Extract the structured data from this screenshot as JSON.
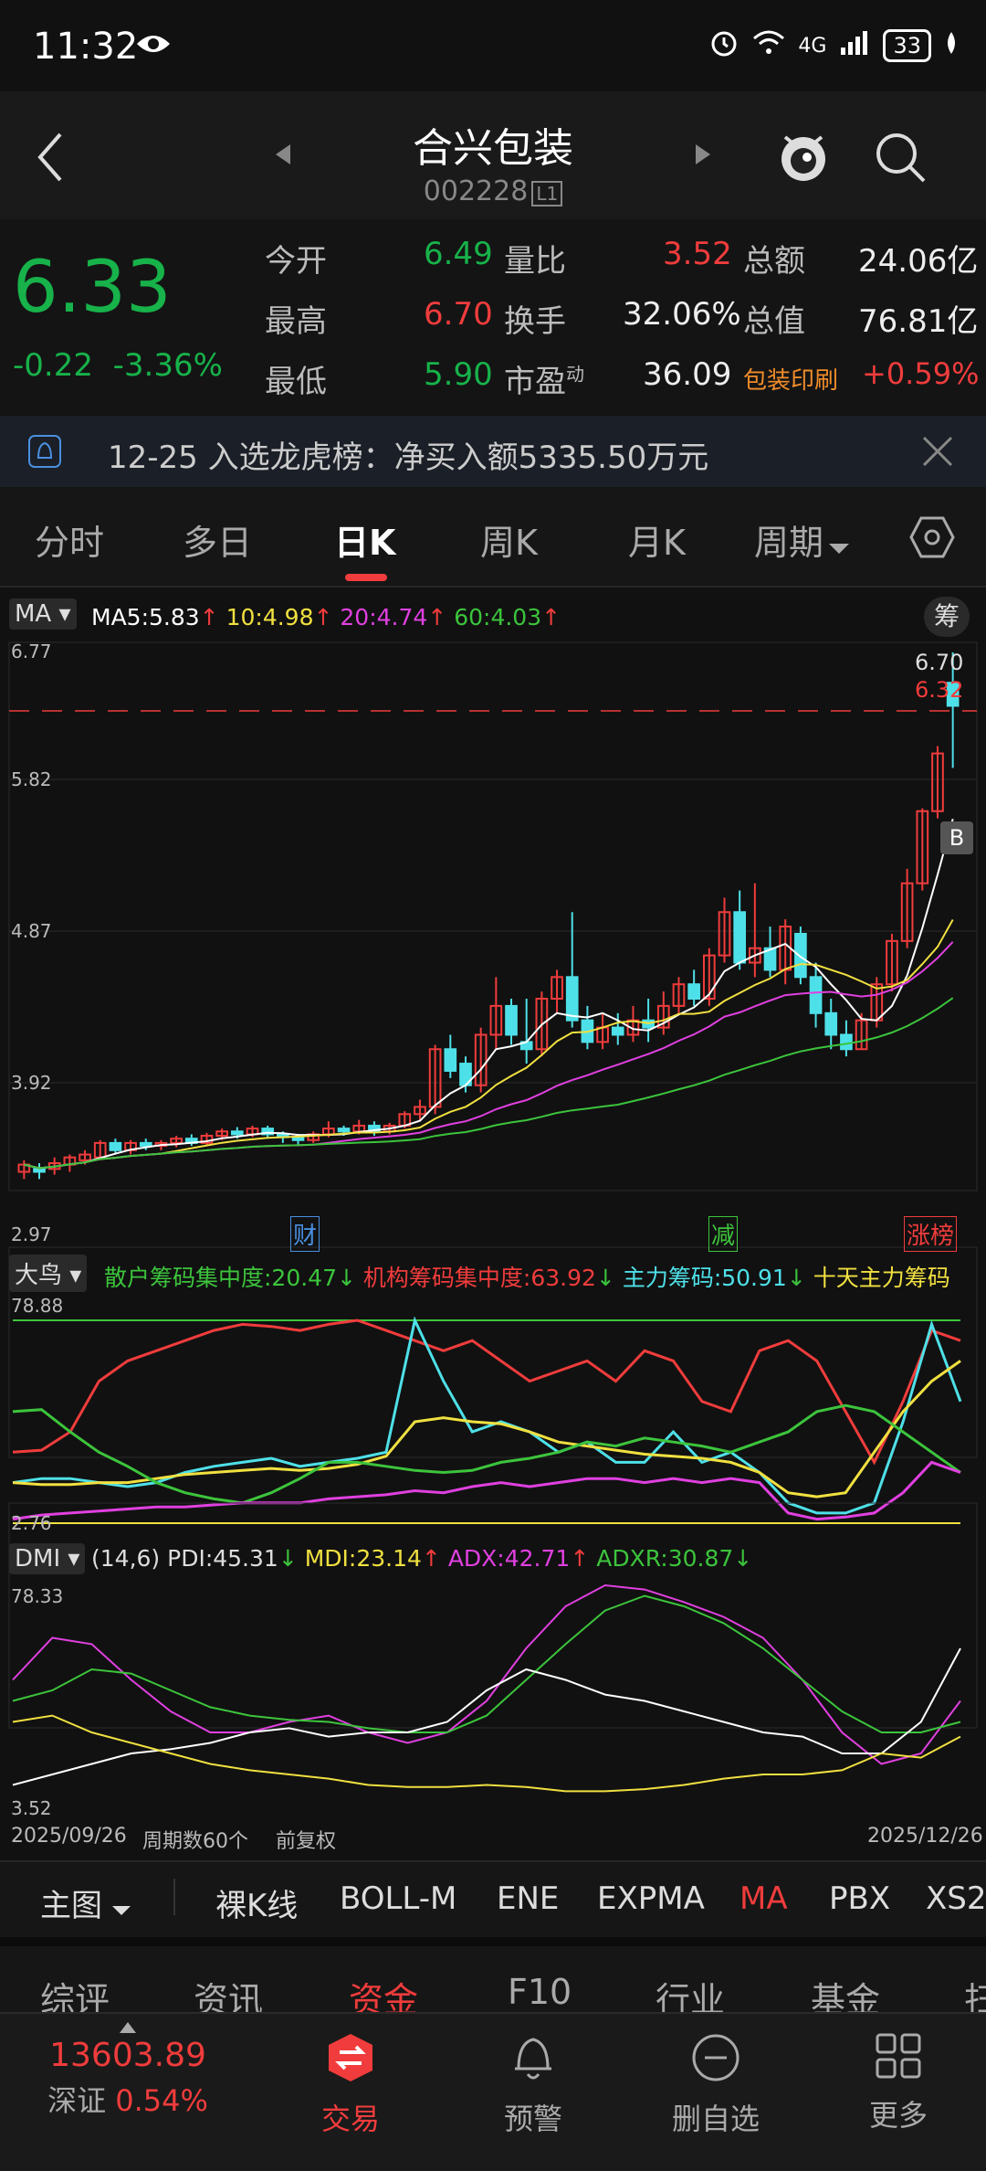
{
  "status": {
    "time": "11:32",
    "network": "4G",
    "battery": "33"
  },
  "header": {
    "title": "合兴包装",
    "code": "002228",
    "code_tag": "L1"
  },
  "quote": {
    "price": "6.33",
    "change": "-0.22",
    "change_pct": "-3.36%",
    "open_label": "今开",
    "open": "6.49",
    "high_label": "最高",
    "high": "6.70",
    "low_label": "最低",
    "low": "5.90",
    "vol_ratio_label": "量比",
    "vol_ratio": "3.52",
    "turnover_label": "换手",
    "turnover": "32.06%",
    "pe_label": "市盈",
    "pe_sup": "动",
    "pe": "36.09",
    "amount_label": "总额",
    "amount": "24.06亿",
    "mktcap_label": "总值",
    "mktcap": "76.81亿",
    "sector": "包装印刷",
    "sector_pct": "+0.59%"
  },
  "notice": {
    "text": "12-25 入选龙虎榜：净买入额5335.50万元"
  },
  "period_tabs": [
    "分时",
    "多日",
    "日K",
    "周K",
    "月K",
    "周期"
  ],
  "active_period": "日K",
  "main_chart": {
    "indicator": "MA",
    "ma5": "MA5:5.83",
    "ma10": "10:4.98",
    "ma20": "20:4.74",
    "ma60": "60:4.03",
    "chip_btn": "筹",
    "y_labels": [
      "6.77",
      "5.82",
      "4.87",
      "3.92",
      "2.97"
    ],
    "high_mark": "6.70",
    "last_mark": "6.32",
    "buy_mark": "B",
    "event_marks": [
      "财",
      "减",
      "涨榜"
    ]
  },
  "chip_panel": {
    "name": "大鸟",
    "retail": "散户筹码集中度:20.47",
    "inst": "机构筹码集中度:63.92",
    "main": "主力筹码:50.91",
    "ten_day": "十天主力筹码",
    "ymax": "78.88",
    "ymin": "2.76"
  },
  "dmi_panel": {
    "name": "DMI",
    "params": "(14,6)",
    "pdi": "PDI:45.31",
    "mdi": "MDI:23.14",
    "adx": "ADX:42.71",
    "adxr": "ADXR:30.87",
    "ymax": "78.33",
    "ymin": "3.52"
  },
  "date_axis": {
    "start": "2025/09/26",
    "periods": "周期数60个",
    "adjust": "前复权",
    "end": "2025/12/26"
  },
  "indicator_bar": {
    "main_label": "主图",
    "items": [
      "裸K线",
      "BOLL-M",
      "ENE",
      "EXPMA",
      "MA",
      "PBX",
      "XS2"
    ],
    "active": "MA"
  },
  "info_tabs": [
    "综评",
    "资讯",
    "资金",
    "F10",
    "行业",
    "基金",
    "扫"
  ],
  "active_info_tab": "资金",
  "bottom_nav": {
    "index_value": "13603.89",
    "index_name": "深证",
    "index_pct": "0.54%",
    "trade": "交易",
    "alert": "预警",
    "remove": "删自选",
    "more": "更多"
  },
  "colors": {
    "up": "#f03c3c",
    "down": "#17b24a",
    "accent": "#f03c3c"
  },
  "candles": [
    [
      3.1,
      3.15,
      3.05,
      3.18
    ],
    [
      3.12,
      3.1,
      3.05,
      3.16
    ],
    [
      3.12,
      3.16,
      3.08,
      3.2
    ],
    [
      3.15,
      3.2,
      3.1,
      3.22
    ],
    [
      3.18,
      3.22,
      3.15,
      3.25
    ],
    [
      3.2,
      3.3,
      3.18,
      3.32
    ],
    [
      3.3,
      3.25,
      3.22,
      3.33
    ],
    [
      3.25,
      3.3,
      3.22,
      3.32
    ],
    [
      3.3,
      3.28,
      3.25,
      3.33
    ],
    [
      3.28,
      3.3,
      3.25,
      3.32
    ],
    [
      3.3,
      3.33,
      3.27,
      3.35
    ],
    [
      3.33,
      3.3,
      3.28,
      3.36
    ],
    [
      3.3,
      3.35,
      3.28,
      3.37
    ],
    [
      3.35,
      3.38,
      3.32,
      3.4
    ],
    [
      3.38,
      3.36,
      3.33,
      3.41
    ],
    [
      3.36,
      3.4,
      3.34,
      3.42
    ],
    [
      3.4,
      3.36,
      3.33,
      3.42
    ],
    [
      3.36,
      3.34,
      3.3,
      3.38
    ],
    [
      3.34,
      3.32,
      3.28,
      3.36
    ],
    [
      3.32,
      3.36,
      3.3,
      3.38
    ],
    [
      3.36,
      3.4,
      3.34,
      3.45
    ],
    [
      3.4,
      3.38,
      3.35,
      3.42
    ],
    [
      3.38,
      3.42,
      3.36,
      3.46
    ],
    [
      3.42,
      3.38,
      3.35,
      3.45
    ],
    [
      3.38,
      3.42,
      3.36,
      3.44
    ],
    [
      3.42,
      3.5,
      3.4,
      3.52
    ],
    [
      3.5,
      3.55,
      3.45,
      3.6
    ],
    [
      3.55,
      3.95,
      3.5,
      3.98
    ],
    [
      3.95,
      3.8,
      3.75,
      4.05
    ],
    [
      3.85,
      3.7,
      3.65,
      3.9
    ],
    [
      3.7,
      4.05,
      3.65,
      4.1
    ],
    [
      4.05,
      4.25,
      3.95,
      4.45
    ],
    [
      4.25,
      4.05,
      3.98,
      4.3
    ],
    [
      4.0,
      3.95,
      3.85,
      4.3
    ],
    [
      3.95,
      4.3,
      3.9,
      4.35
    ],
    [
      4.3,
      4.45,
      4.2,
      4.5
    ],
    [
      4.45,
      4.15,
      4.1,
      4.9
    ],
    [
      4.15,
      4.0,
      3.95,
      4.25
    ],
    [
      4.0,
      4.1,
      3.95,
      4.2
    ],
    [
      4.1,
      4.05,
      3.98,
      4.2
    ],
    [
      4.05,
      4.15,
      4.0,
      4.25
    ],
    [
      4.15,
      4.1,
      4.0,
      4.3
    ],
    [
      4.1,
      4.25,
      4.05,
      4.35
    ],
    [
      4.25,
      4.4,
      4.2,
      4.45
    ],
    [
      4.4,
      4.3,
      4.25,
      4.5
    ],
    [
      4.3,
      4.6,
      4.25,
      4.65
    ],
    [
      4.6,
      4.9,
      4.55,
      5.0
    ],
    [
      4.9,
      4.55,
      4.5,
      5.05
    ],
    [
      4.55,
      4.65,
      4.45,
      5.1
    ],
    [
      4.65,
      4.5,
      4.45,
      4.8
    ],
    [
      4.5,
      4.8,
      4.4,
      4.85
    ],
    [
      4.75,
      4.45,
      4.4,
      4.8
    ],
    [
      4.45,
      4.2,
      4.1,
      4.55
    ],
    [
      4.2,
      4.05,
      3.95,
      4.3
    ],
    [
      4.05,
      3.95,
      3.9,
      4.15
    ],
    [
      3.95,
      4.15,
      3.95,
      4.2
    ],
    [
      4.15,
      4.4,
      4.1,
      4.45
    ],
    [
      4.4,
      4.7,
      4.35,
      4.75
    ],
    [
      4.7,
      5.1,
      4.65,
      5.2
    ],
    [
      5.1,
      5.6,
      5.05,
      5.62
    ],
    [
      5.6,
      6.0,
      5.55,
      6.05
    ],
    [
      6.49,
      6.33,
      5.9,
      6.7
    ]
  ]
}
